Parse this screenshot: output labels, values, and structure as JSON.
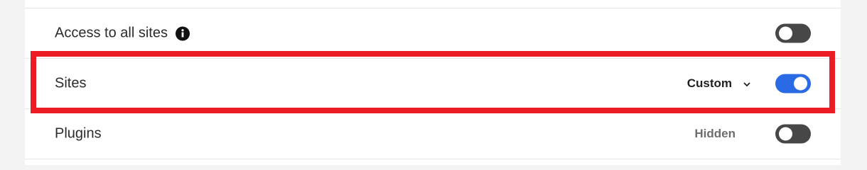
{
  "rows": [
    {
      "label": "Access to all sites",
      "info_icon": "info-circle-icon",
      "toggle_on": false
    },
    {
      "label": "Sites",
      "value": "Custom",
      "dropdown_icon": "chevron-down-icon",
      "toggle_on": true
    },
    {
      "label": "Plugins",
      "value": "Hidden",
      "toggle_on": false
    }
  ],
  "colors": {
    "toggle_off": "#474747",
    "toggle_on": "#2a6ae5",
    "highlight": "#ec1c24",
    "hidden_text": "#6d6d6d"
  }
}
